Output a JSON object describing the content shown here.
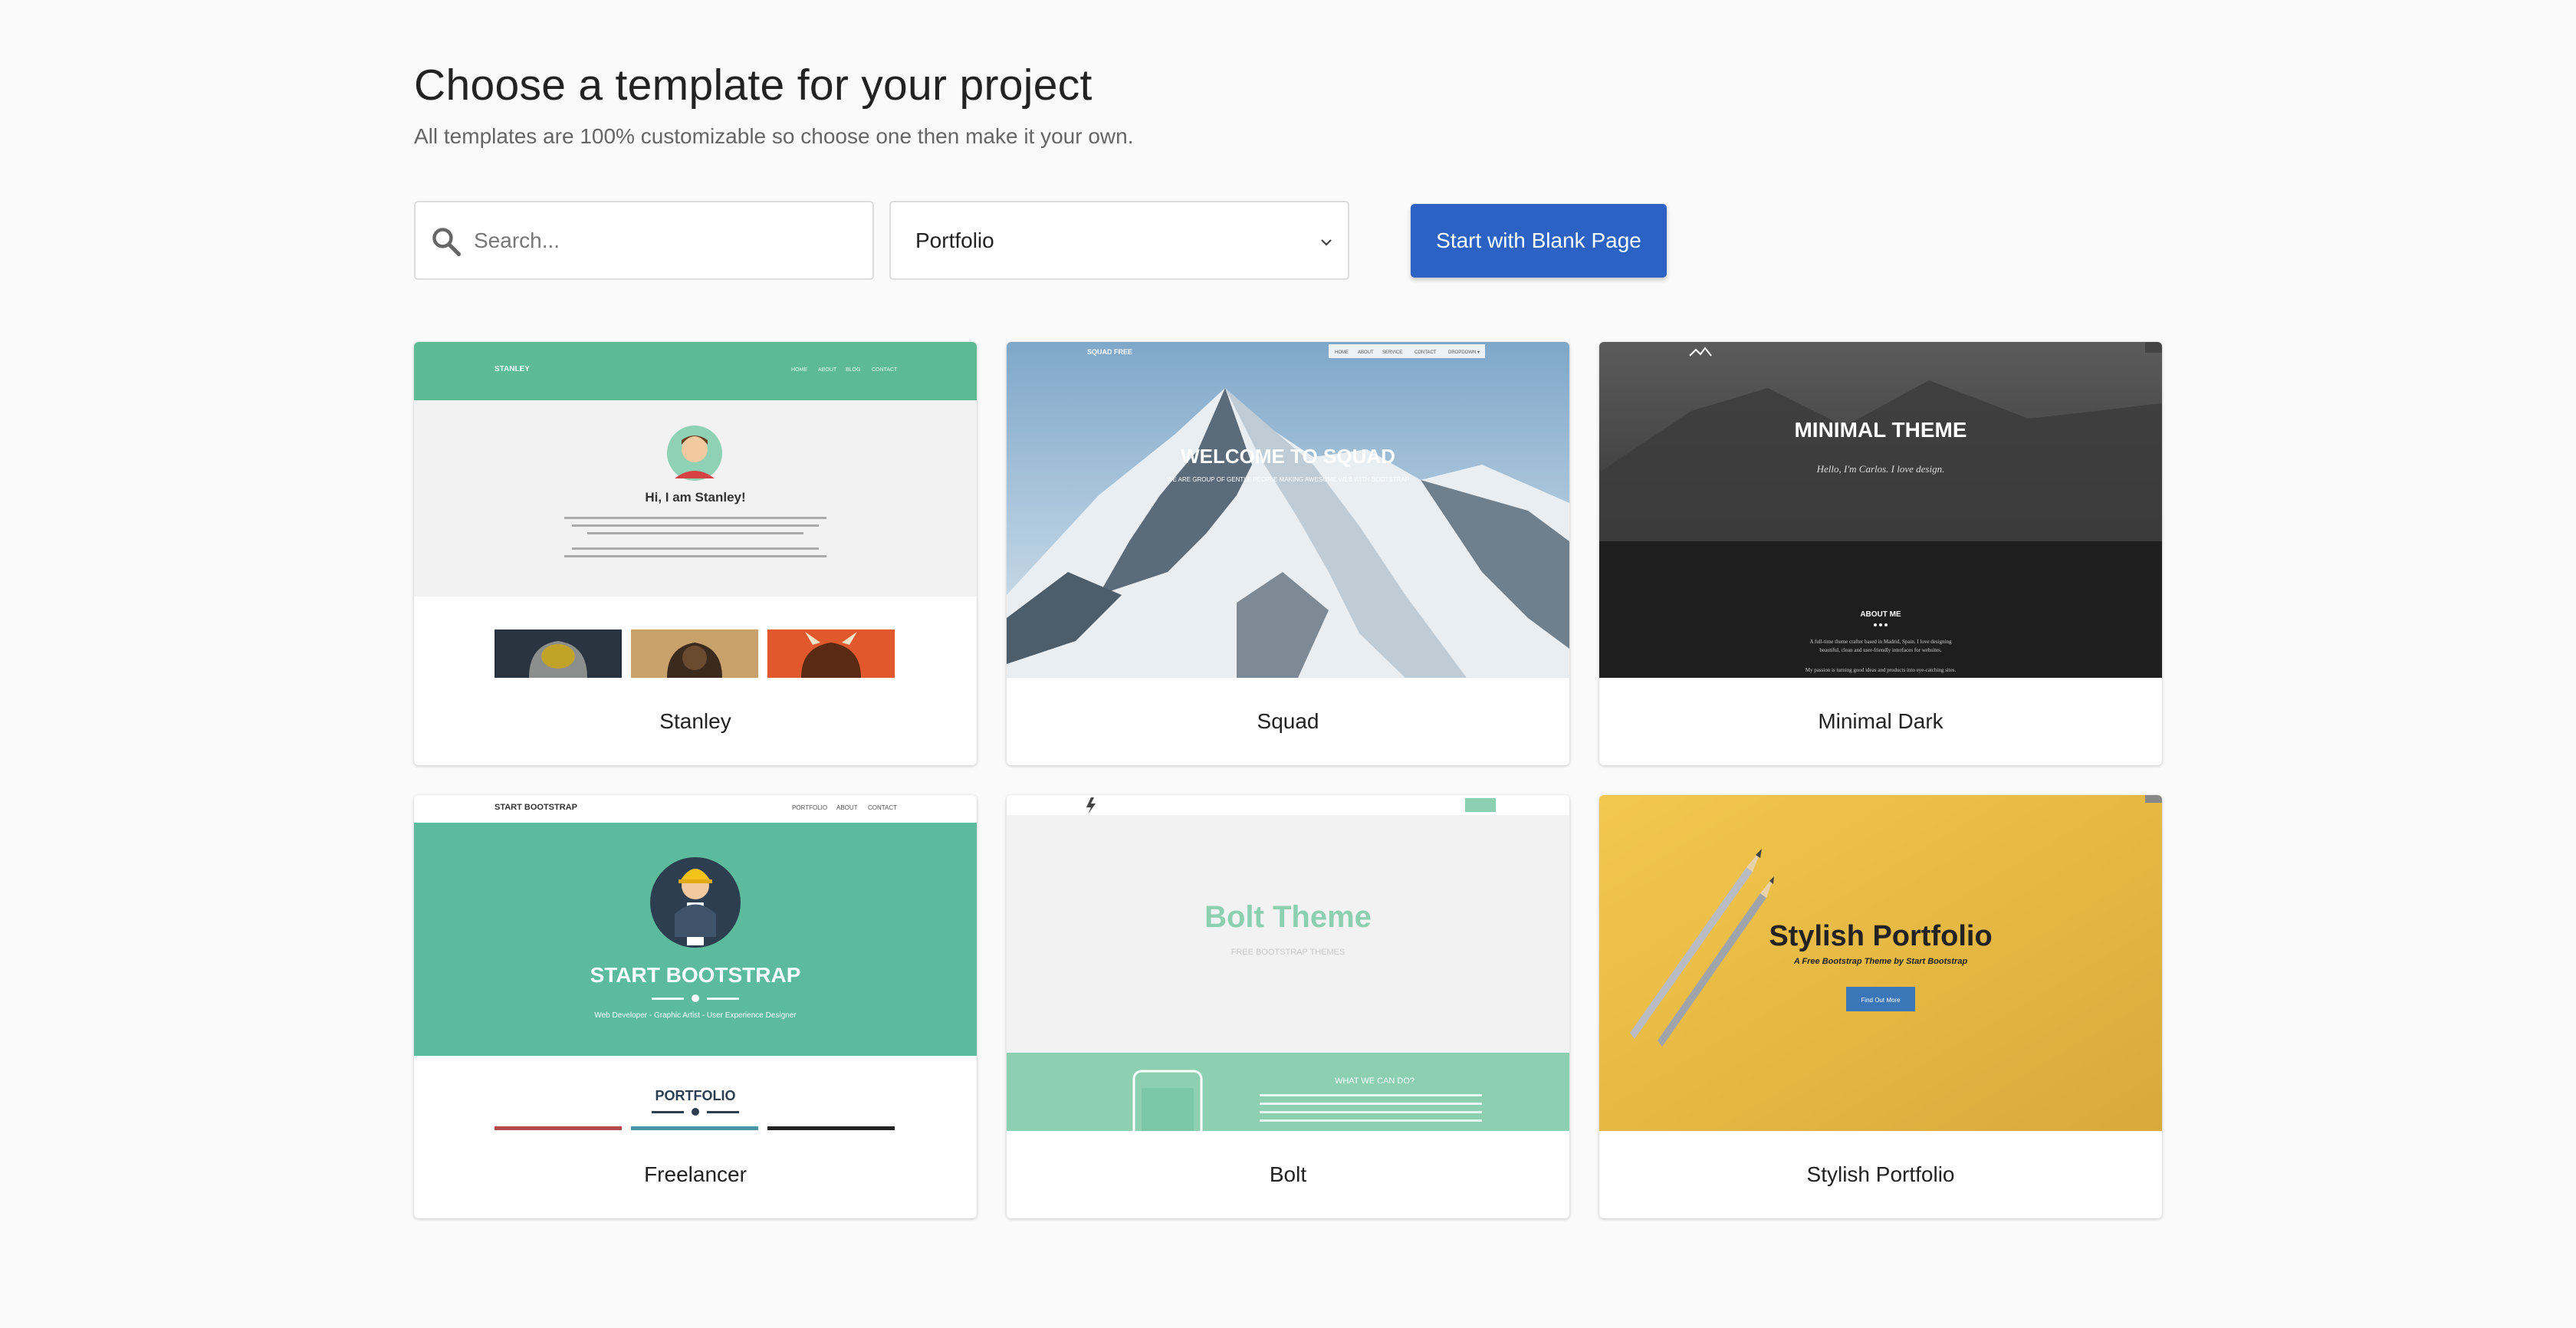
{
  "header": {
    "title": "Choose a template for your project",
    "subtitle": "All templates are 100% customizable so choose one then make it your own."
  },
  "toolbar": {
    "search_placeholder": "Search...",
    "category_selected": "Portfolio",
    "blank_button_label": "Start with Blank Page"
  },
  "templates": [
    {
      "name": "Stanley",
      "preview": {
        "brand": "STANLEY",
        "nav": [
          "HOME",
          "ABOUT",
          "BLOG",
          "CONTACT"
        ],
        "heading": "Hi, I am Stanley!",
        "accent": "#5cbb96"
      }
    },
    {
      "name": "Squad",
      "preview": {
        "brand": "SQUAD FREE",
        "nav": [
          "HOME",
          "ABOUT",
          "SERVICE",
          "CONTACT",
          "DROPDOWN ▾"
        ],
        "heading": "WELCOME TO SQUAD",
        "tagline": "WE ARE GROUP OF GENTLE PEOPLE MAKING AWESOME WEB WITH BOOTSTRAP"
      }
    },
    {
      "name": "Minimal Dark",
      "preview": {
        "heading": "MINIMAL THEME",
        "tagline": "Hello, I'm Carlos. I love design.",
        "section": "ABOUT ME",
        "body_lines": [
          "A full-time theme crafter based in Madrid, Spain. I love designing",
          "beautiful, clean and user-friendly interfaces for websites.",
          "My passion is turning good ideas and products into eye-catching sites."
        ]
      }
    },
    {
      "name": "Freelancer",
      "preview": {
        "brand": "START BOOTSTRAP",
        "nav": [
          "PORTFOLIO",
          "ABOUT",
          "CONTACT"
        ],
        "heading": "START BOOTSTRAP",
        "tagline": "Web Developer - Graphic Artist - User Experience Designer",
        "section": "PORTFOLIO",
        "accent": "#5cbb9c"
      }
    },
    {
      "name": "Bolt",
      "preview": {
        "heading": "Bolt Theme",
        "tagline": "FREE BOOTSTRAP THEMES",
        "section": "WHAT WE CAN DO?",
        "accent": "#8ccfb1"
      }
    },
    {
      "name": "Stylish Portfolio",
      "preview": {
        "heading": "Stylish Portfolio",
        "tagline": "A Free Bootstrap Theme by Start Bootstrap",
        "button": "Find Out More",
        "accent": "#f0c44a"
      }
    }
  ],
  "colors": {
    "primary_button": "#2b62c4",
    "background": "#fafafa"
  }
}
